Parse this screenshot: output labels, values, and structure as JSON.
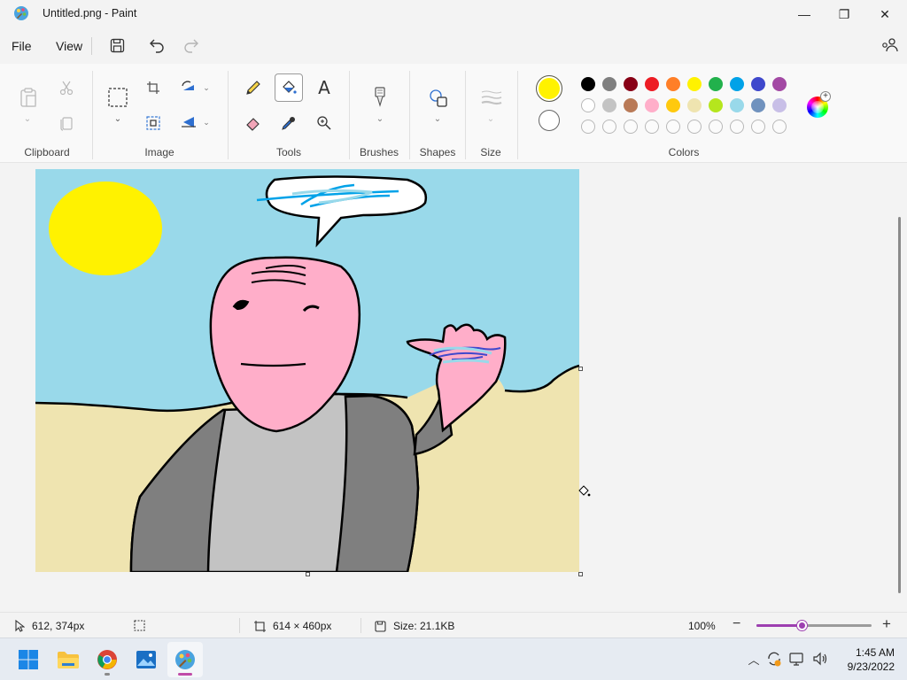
{
  "window": {
    "title": "Untitled.png - Paint",
    "minimize_glyph": "—",
    "maximize_glyph": "❐",
    "close_glyph": "✕"
  },
  "menu": {
    "file": "File",
    "view": "View",
    "icons": [
      "save-icon",
      "undo-icon",
      "redo-icon",
      "share-icon"
    ]
  },
  "ribbon": {
    "groups": {
      "clipboard": "Clipboard",
      "image": "Image",
      "tools": "Tools",
      "brushes": "Brushes",
      "shapes": "Shapes",
      "size": "Size",
      "colors": "Colors"
    },
    "active_tool": "fill-bucket",
    "primary_color": "#fff200",
    "secondary_color": "#ffffff",
    "palette_row1": [
      "#000000",
      "#7f7f7f",
      "#880015",
      "#ed1c24",
      "#ff7f27",
      "#fff200",
      "#22b14c",
      "#00a2e8",
      "#3f48cc",
      "#a349a4"
    ],
    "palette_row2": [
      "#ffffff",
      "#c3c3c3",
      "#b97a57",
      "#ffaec9",
      "#ffc90e",
      "#efe4b0",
      "#b5e61d",
      "#99d9ea",
      "#7092be",
      "#c8bfe7"
    ],
    "palette_row3_custom_slots": 10
  },
  "status": {
    "cursor_position": "612, 374px",
    "canvas_size": "614 × 460px",
    "file_size": "Size: 21.1KB",
    "zoom": "100%",
    "zoom_level": 0.4
  },
  "taskbar": {
    "apps": [
      "start-button",
      "file-explorer",
      "chrome",
      "photos",
      "paint"
    ],
    "active_app": "paint",
    "time": "1:45 AM",
    "date": "9/23/2022"
  }
}
